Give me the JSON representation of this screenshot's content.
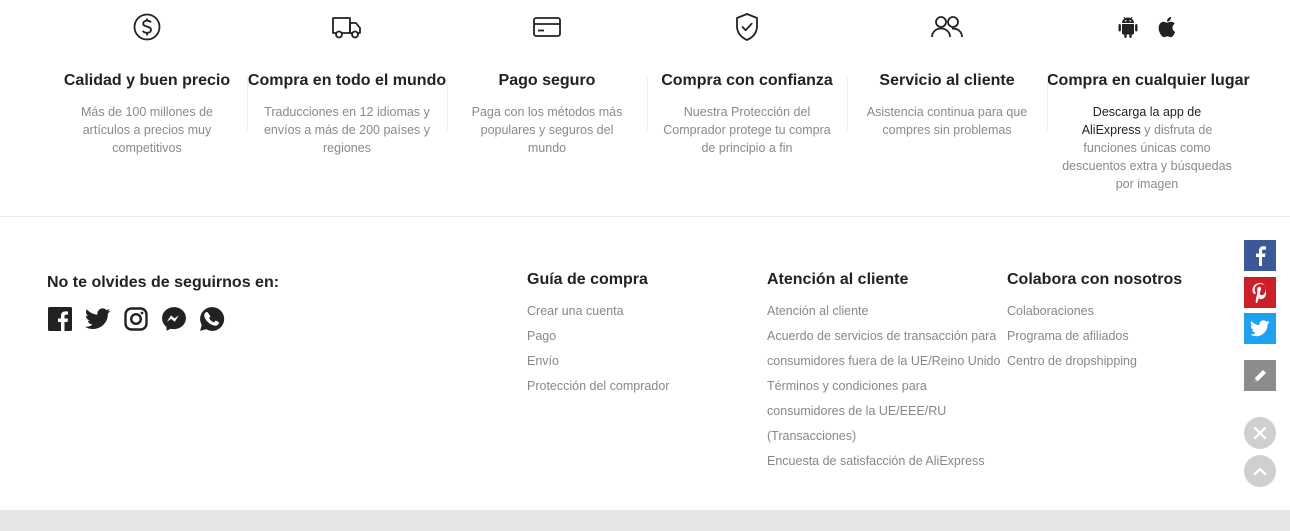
{
  "features": [
    {
      "icon": "dollar-circle-icon",
      "title": "Calidad y buen precio",
      "desc": "Más de 100 millones de artículos a precios muy competitivos"
    },
    {
      "icon": "truck-icon",
      "title": "Compra en todo el mundo",
      "desc": "Traducciones en 12 idiomas y envíos a más de 200 países y regiones"
    },
    {
      "icon": "credit-card-icon",
      "title": "Pago seguro",
      "desc": "Paga con los métodos más populares y seguros del mundo"
    },
    {
      "icon": "shield-check-icon",
      "title": "Compra con confianza",
      "desc": "Nuestra Protección del Comprador protege tu compra de principio a fin"
    },
    {
      "icon": "users-icon",
      "title": "Servicio al cliente",
      "desc": "Asistencia continua para que compres sin problemas"
    },
    {
      "icon": "android-apple-icon",
      "title": "Compra en cualquier lugar",
      "desc_link": "Descarga la app de AliExpress",
      "desc": "y disfruta de funciones únicas como descuentos extra y búsquedas por imagen"
    }
  ],
  "follow": {
    "title": "No te olvides de seguirnos en:",
    "icons": [
      "facebook-icon",
      "twitter-icon",
      "instagram-icon",
      "messenger-icon",
      "whatsapp-icon"
    ]
  },
  "columns": {
    "guia": {
      "title": "Guía de compra",
      "items": [
        "Crear una cuenta",
        "Pago",
        "Envío",
        "Protección del comprador"
      ]
    },
    "atencion": {
      "title": "Atención al cliente",
      "items": [
        "Atención al cliente",
        "Acuerdo de servicios de transacción para",
        "consumidores fuera de la UE/Reino Unido",
        "Términos y condiciones para",
        "consumidores de la UE/EEE/RU",
        "(Transacciones)",
        "Encuesta de satisfacción de AliExpress"
      ]
    },
    "colabora": {
      "title": "Colabora con nosotros",
      "items": [
        "Colaboraciones",
        "Programa de afiliados",
        "Centro de dropshipping"
      ]
    }
  },
  "share_bar": {
    "buttons": [
      "facebook-share",
      "pinterest-share",
      "twitter-share",
      "edit"
    ],
    "colors": {
      "facebook": "#3b5998",
      "pinterest": "#cb2027",
      "twitter": "#1da1f2",
      "edit": "#8c8c8c"
    }
  }
}
